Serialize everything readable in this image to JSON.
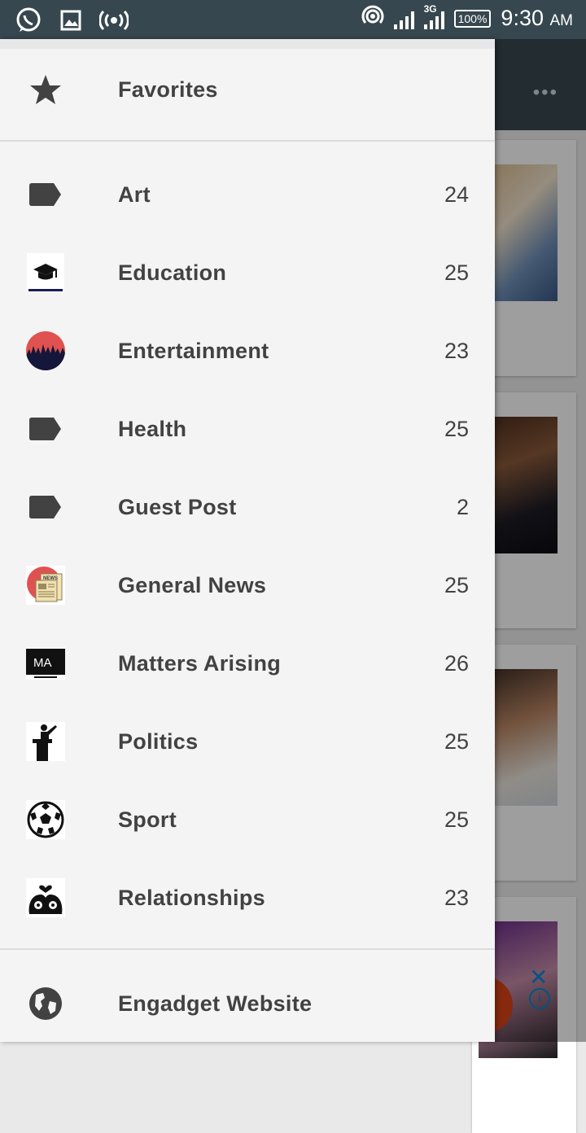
{
  "status_bar": {
    "time": "9:30",
    "ampm": "AM",
    "battery": "100%",
    "network": "3G",
    "icons": [
      "whatsapp-icon",
      "image-icon",
      "radio-broadcast-icon",
      "hotspot-icon",
      "signal-icon",
      "battery-icon"
    ]
  },
  "drawer": {
    "favorites_label": "Favorites",
    "categories": [
      {
        "label": "Art",
        "count": "24",
        "icon": "tag-icon"
      },
      {
        "label": "Education",
        "count": "25",
        "icon": "graduation-cap-icon"
      },
      {
        "label": "Entertainment",
        "count": "23",
        "icon": "crowd-icon"
      },
      {
        "label": "Health",
        "count": "25",
        "icon": "tag-icon"
      },
      {
        "label": "Guest Post",
        "count": "2",
        "icon": "tag-icon"
      },
      {
        "label": "General News",
        "count": "25",
        "icon": "newspaper-icon"
      },
      {
        "label": "Matters Arising",
        "count": "26",
        "icon": "ma-logo-icon"
      },
      {
        "label": "Politics",
        "count": "25",
        "icon": "podium-speaker-icon"
      },
      {
        "label": "Sport",
        "count": "25",
        "icon": "soccer-ball-icon"
      },
      {
        "label": "Relationships",
        "count": "23",
        "icon": "couple-heart-icon"
      }
    ],
    "website_label": "Engadget Website",
    "ma_logo_text": "MA",
    "news_icon_text": "NEWS"
  },
  "colors": {
    "status_bar": "#37474f",
    "drawer_bg": "#f4f4f4",
    "text": "#424242",
    "icon": "#424242"
  }
}
